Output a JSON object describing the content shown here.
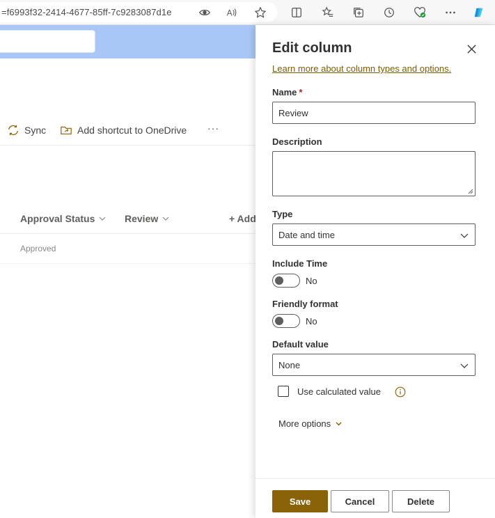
{
  "browser": {
    "url": "=f6993f32-2414-4677-85ff-7c9283087d1e",
    "toolbar_icons": [
      "eye-icon",
      "read-aloud-icon",
      "favorite-star-icon",
      "split-screen-icon",
      "favorites-icon",
      "collections-icon",
      "history-icon",
      "browser-essentials-icon",
      "more-icon",
      "copilot-icon"
    ]
  },
  "commandbar": {
    "sync_label": "Sync",
    "shortcut_label": "Add shortcut to OneDrive",
    "more_label": "···"
  },
  "list": {
    "columns": [
      "Approval Status",
      "Review"
    ],
    "add_column_label": "+ Add",
    "rows": [
      [
        "Approved"
      ]
    ]
  },
  "panel": {
    "title": "Edit column",
    "learn_more_link": "Learn more about column types and options.",
    "name_label": "Name",
    "required_marker": "*",
    "name_value": "Review",
    "description_label": "Description",
    "description_value": "",
    "type_label": "Type",
    "type_value": "Date and time",
    "include_time_label": "Include Time",
    "include_time_state": "No",
    "friendly_format_label": "Friendly format",
    "friendly_format_state": "No",
    "default_value_label": "Default value",
    "default_value": "None",
    "use_calculated_label": "Use calculated value",
    "more_options_label": "More options",
    "save_label": "Save",
    "cancel_label": "Cancel",
    "delete_label": "Delete"
  },
  "colors": {
    "accent": "#8a6208",
    "link": "#7a5c07",
    "header_band": "#a8c7f6"
  }
}
